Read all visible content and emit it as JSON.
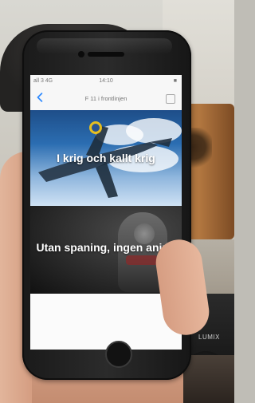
{
  "scene": {
    "camera_brand": "LUMIX"
  },
  "app": {
    "status_bar": {
      "carrier": "all 3 4G",
      "time": "14:10",
      "battery": "■"
    },
    "nav": {
      "title": "F 11 i frontlinjen"
    },
    "cards": [
      {
        "title": "I krig och kallt krig"
      },
      {
        "title": "Utan spaning, ingen aning"
      }
    ]
  }
}
